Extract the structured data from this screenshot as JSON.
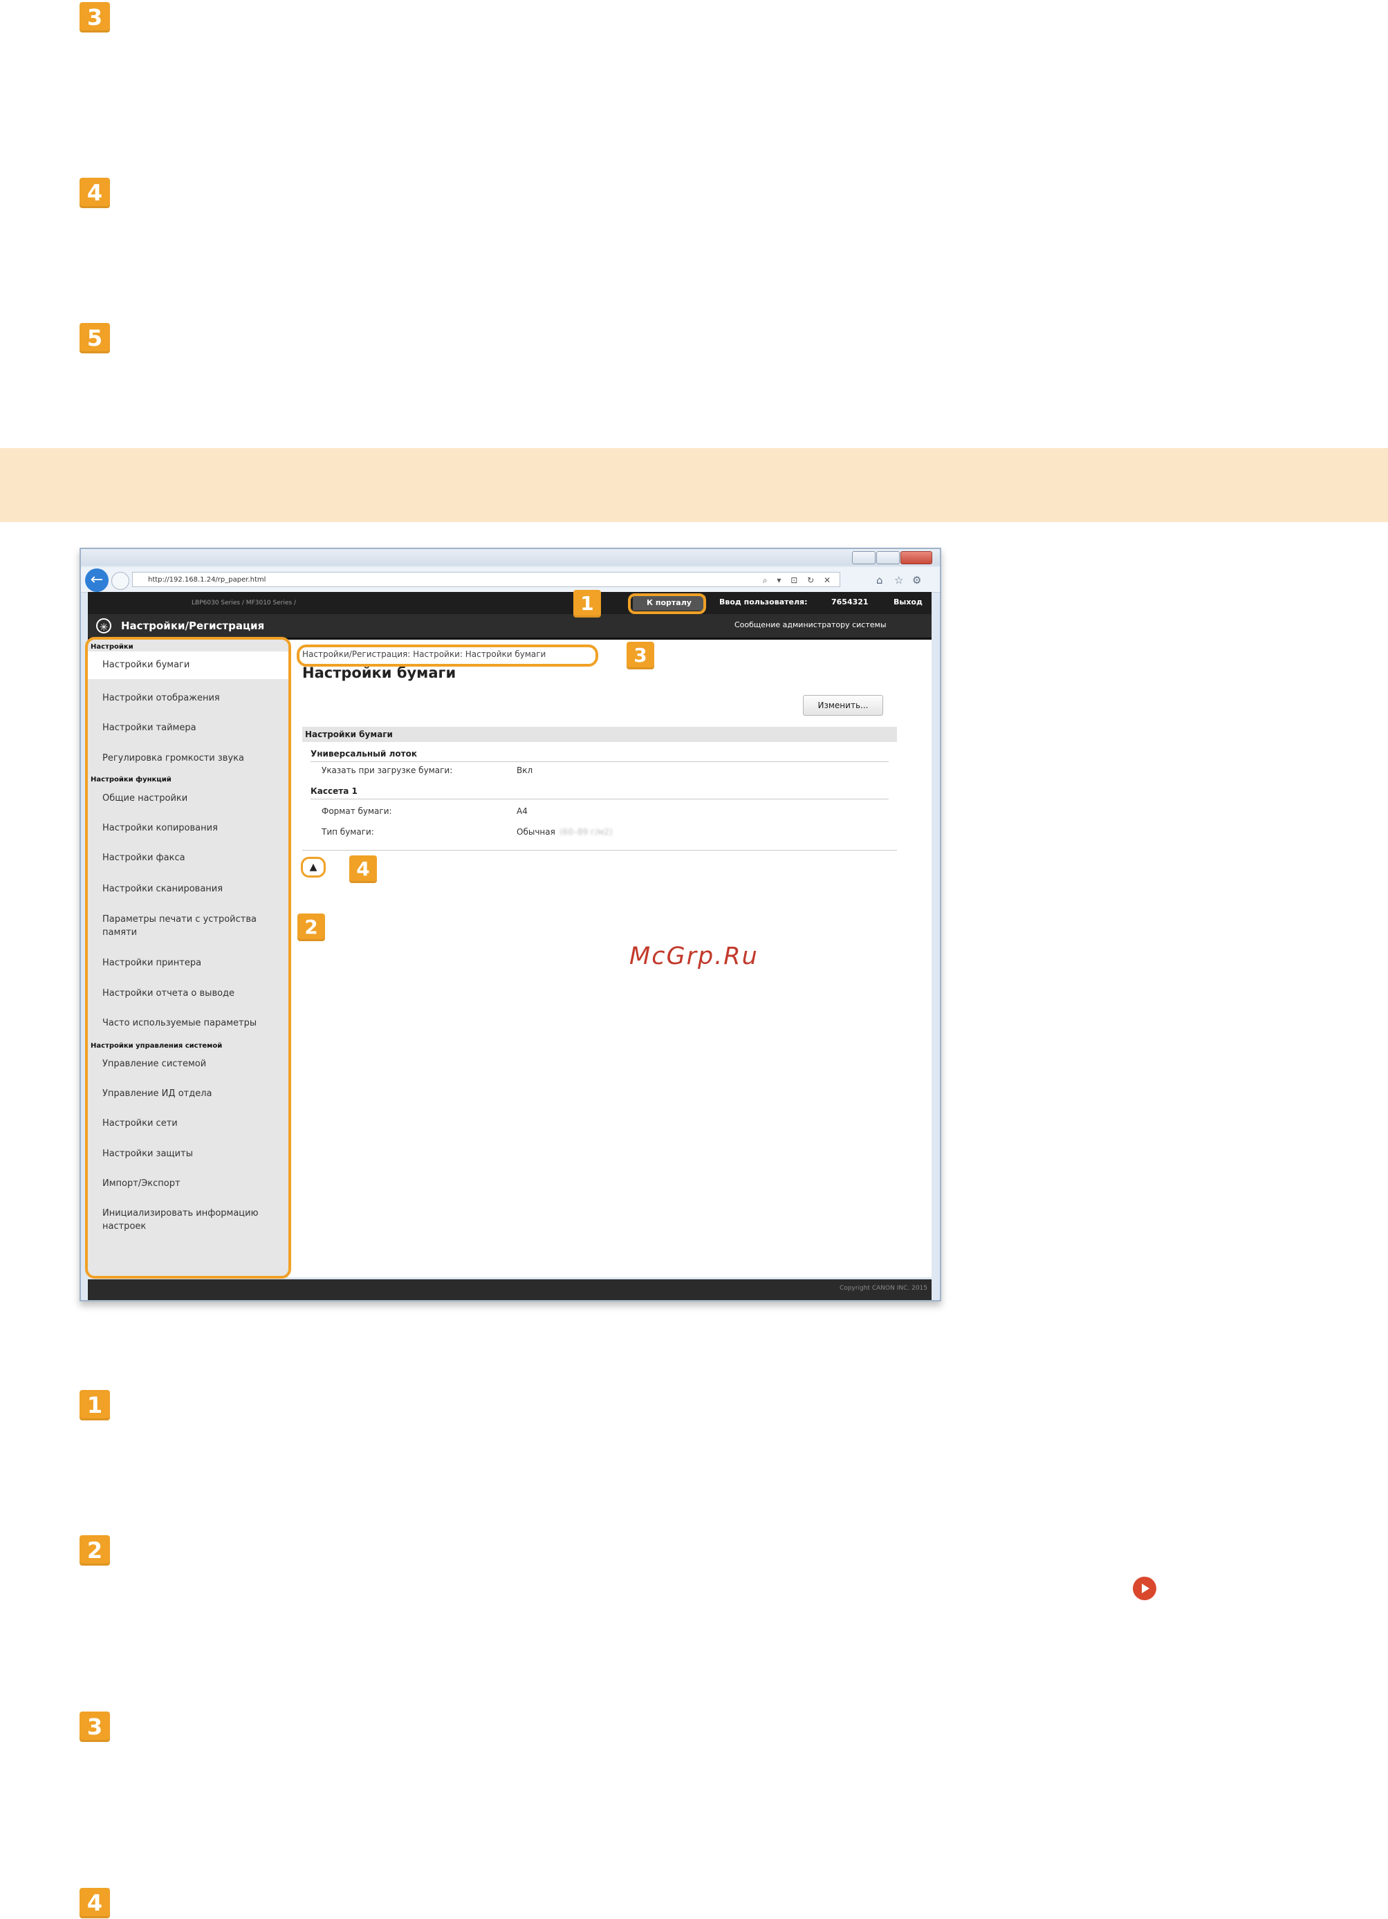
{
  "steps_top": [
    "3",
    "4",
    "5"
  ],
  "steps_bottom": [
    "1",
    "2",
    "3",
    "4"
  ],
  "browser": {
    "url": "http://192.168.1.24/rp_paper.html",
    "url_tools": "⌕ ▾ ⊡ ↻ ✕"
  },
  "header": {
    "device_info": "LBP6030 Series / MF3010 Series /",
    "app_title": "Настройки/Регистрация",
    "portal_button": "К порталу",
    "login_label": "Ввод пользователя:",
    "login_value": "7654321",
    "logout": "Выход",
    "message": "Сообщение администратору системы"
  },
  "sidebar": {
    "sections": [
      {
        "title": "Настройки",
        "items": [
          "Настройки бумаги",
          "Настройки отображения",
          "Настройки таймера",
          "Регулировка громкости звука"
        ]
      },
      {
        "title": "Настройки функций",
        "items": [
          "Общие настройки",
          "Настройки копирования",
          "Настройки факса",
          "Настройки сканирования",
          "Параметры печати с устройства памяти",
          "Настройки принтера",
          "Настройки отчета о выводе",
          "Часто используемые параметры"
        ]
      },
      {
        "title": "Настройки управления системой",
        "items": [
          "Управление системой",
          "Управление ИД отдела",
          "Настройки сети",
          "Настройки защиты",
          "Импорт/Экспорт",
          "Инициализировать информацию настроек"
        ]
      }
    ]
  },
  "main": {
    "breadcrumb": "Настройки/Регистрация: Настройки: Настройки бумаги",
    "page_title": "Настройки бумаги",
    "edit_button": "Изменить...",
    "section_title": "Настройки бумаги",
    "group1_title": "Универсальный лоток",
    "row1_label": "Указать при загрузке бумаги:",
    "row1_value": "Вкл",
    "group2_title": "Кассета 1",
    "row2_label": "Формат бумаги:",
    "row2_value": "A4",
    "row3_label": "Тип бумаги:",
    "row3_value": "Обычная",
    "row3_extra": "(60–89 г/м2)",
    "top_icon": "▲"
  },
  "footer_copy": "Copyright CANON INC. 2015",
  "callouts": [
    "1",
    "2",
    "3",
    "4"
  ],
  "watermark": "McGrp.Ru"
}
